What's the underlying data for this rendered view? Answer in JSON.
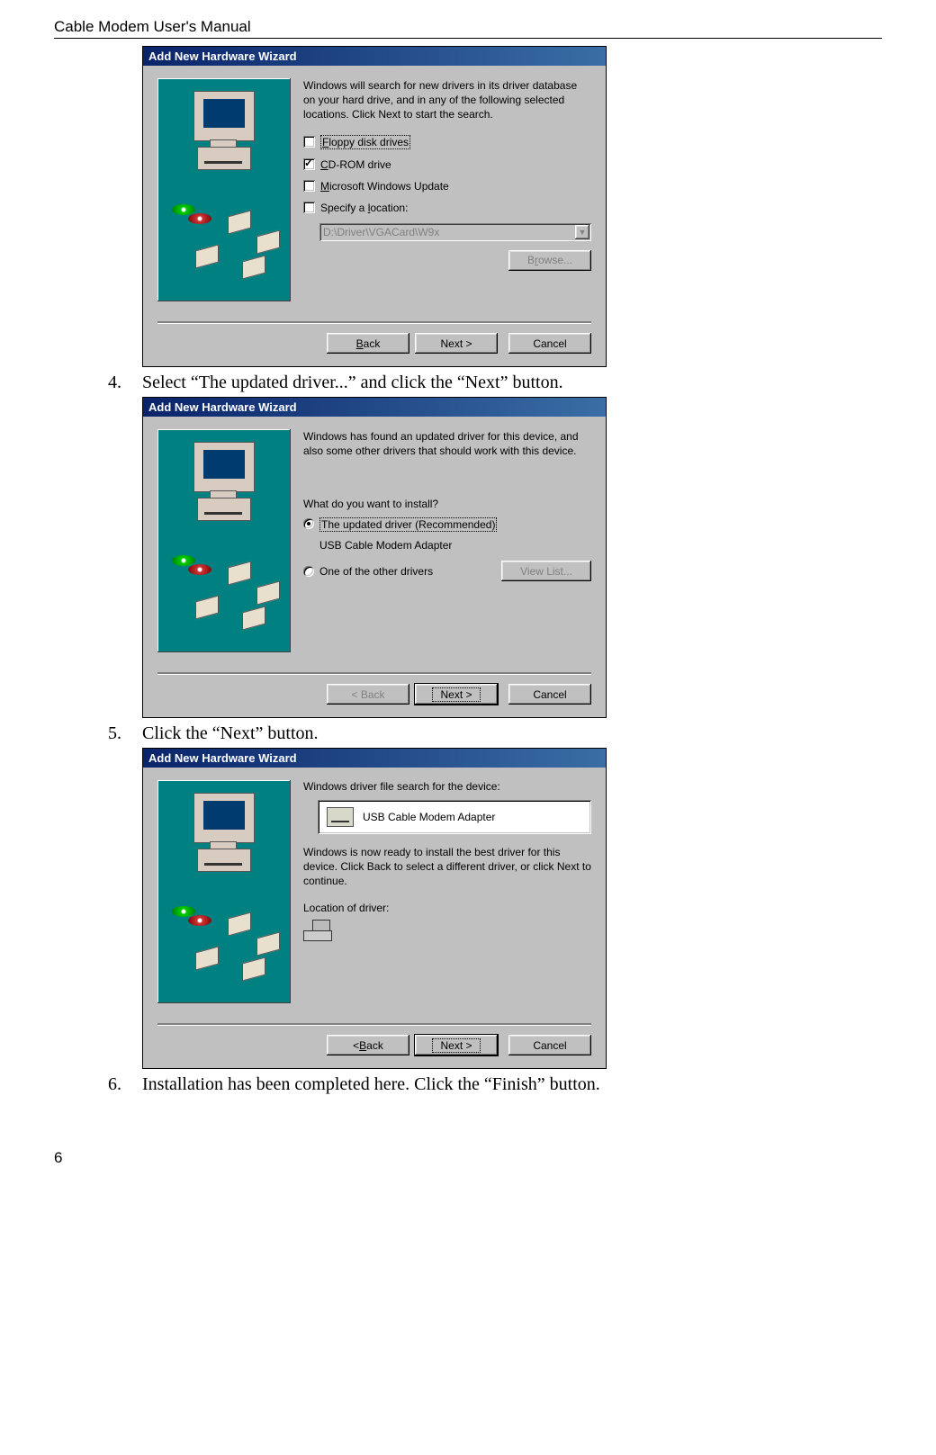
{
  "header": "Cable Modem User's Manual",
  "page_number": "6",
  "steps": {
    "s4_num": "4.",
    "s4_text": "Select “The updated driver...” and click the “Next” button.",
    "s5_num": "5.",
    "s5_text": "Click the “Next” button.",
    "s6_num": "6.",
    "s6_text": "Installation has been completed here. Click the “Finish” button."
  },
  "wizard_title": "Add New Hardware Wizard",
  "screen1": {
    "desc": "Windows will search for new drivers in its driver database on your hard drive, and in any of the following selected locations. Click Next to start the search.",
    "opt_floppy_pre": "F",
    "opt_floppy_rest": "loppy disk drives",
    "opt_cd_pre": "C",
    "opt_cd_rest": "D-ROM drive",
    "opt_msupdate_pre": "M",
    "opt_msupdate_rest": "icrosoft Windows Update",
    "opt_specify": "Specify a ",
    "opt_specify_ul": "l",
    "opt_specify_rest": "ocation:",
    "path_value": "D:\\Driver\\VGACard\\W9x",
    "browse_pre": "B",
    "browse_ul": "r",
    "browse_rest": "owse...",
    "back_label": "< Back",
    "next_label": "Next >",
    "cancel_label": "Cancel"
  },
  "screen2": {
    "desc": "Windows has found an updated driver for this device, and also some other drivers that should work with this device.",
    "question": "What do you want to install?",
    "opt_updated_ul": "T",
    "opt_updated_rest": "he updated driver (Recommended)",
    "device_name": "USB Cable Modem Adapter",
    "opt_other_ul": "O",
    "opt_other_rest": "ne of the other drivers",
    "viewlist_label": "View List...",
    "back_label": "< Back",
    "next_label": "Next >",
    "cancel_label": "Cancel"
  },
  "screen3": {
    "line1": "Windows driver file search for the device:",
    "device_name": "USB Cable Modem Adapter",
    "line2": "Windows is now ready to install the best driver for this device. Click Back to select a different driver, or click Next to continue.",
    "loc_label": "Location of driver:",
    "back_label": "< Back",
    "next_label": "Next >",
    "cancel_label": "Cancel"
  }
}
